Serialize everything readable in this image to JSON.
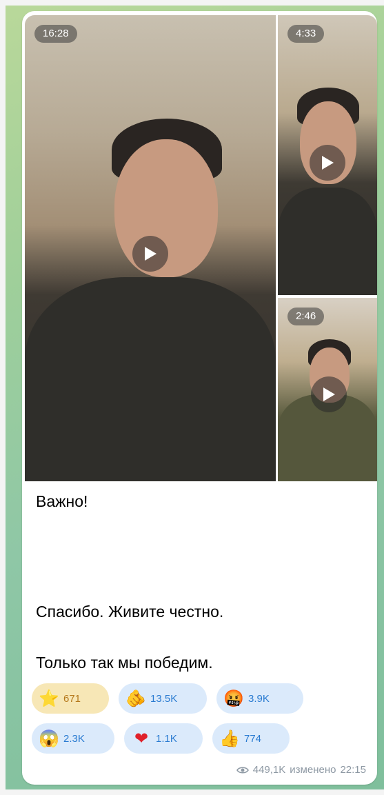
{
  "videos": [
    {
      "duration": "16:28"
    },
    {
      "duration": "4:33"
    },
    {
      "duration": "2:46"
    }
  ],
  "message": {
    "line1": "Важно!",
    "line2": "Спасибо. Живите честно.",
    "line3": "Только так мы победим."
  },
  "reactions": [
    {
      "icon": "star-emoji",
      "emoji": "⭐",
      "count": "671"
    },
    {
      "icon": "pointing-hand-emoji",
      "emoji": "🫵",
      "count": "13.5K"
    },
    {
      "icon": "cursing-face-emoji",
      "emoji": "🤬",
      "count": "3.9K"
    },
    {
      "icon": "scream-emoji",
      "emoji": "😱",
      "count": "2.3K"
    },
    {
      "icon": "heart-emoji",
      "emoji": "❤",
      "count": "1.1K"
    },
    {
      "icon": "thumbs-up-emoji",
      "emoji": "👍",
      "count": "774"
    }
  ],
  "footer": {
    "views": "449,1K",
    "edited_label": "изменено",
    "time": "22:15"
  }
}
